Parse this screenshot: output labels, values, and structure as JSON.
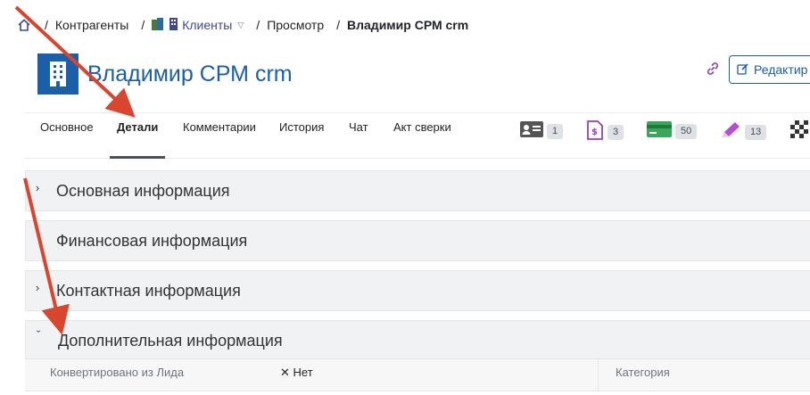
{
  "breadcrumb": {
    "items": [
      {
        "label": "Контрагенты"
      },
      {
        "label": "Клиенты"
      },
      {
        "label": "Просмотр"
      },
      {
        "label": "Владимир СРМ crm"
      }
    ]
  },
  "page": {
    "title": "Владимир СРМ crm",
    "edit_label": "Редактир"
  },
  "tabs": [
    {
      "label": "Основное"
    },
    {
      "label": "Детали"
    },
    {
      "label": "Комментарии"
    },
    {
      "label": "История"
    },
    {
      "label": "Чат"
    },
    {
      "label": "Акт сверки"
    }
  ],
  "counters": [
    {
      "icon": "contact-card-icon",
      "count": "1"
    },
    {
      "icon": "invoice-icon",
      "count": "3"
    },
    {
      "icon": "credit-card-icon",
      "count": "50"
    },
    {
      "icon": "pencil-icon",
      "count": "13"
    }
  ],
  "sections": [
    {
      "title": "Основная информация",
      "expanded": false
    },
    {
      "title": "Финансовая информация",
      "expanded": false
    },
    {
      "title": "Контактная информация",
      "expanded": false
    },
    {
      "title": "Дополнительная информация",
      "expanded": true
    }
  ],
  "details": {
    "converted_label": "Конвертировано из Лида",
    "converted_value": "Нет",
    "category_label": "Категория"
  },
  "colors": {
    "accent": "#1a5fa8",
    "arrow": "#d9462f"
  }
}
